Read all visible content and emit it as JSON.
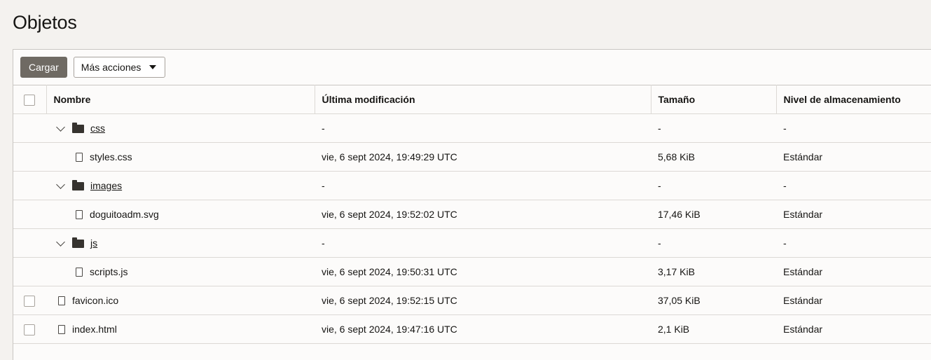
{
  "page": {
    "title": "Objetos"
  },
  "toolbar": {
    "upload_label": "Cargar",
    "more_actions_label": "Más acciones"
  },
  "table": {
    "columns": [
      "Nombre",
      "Última modificación",
      "Tamaño",
      "Nivel de almacenamiento"
    ],
    "rows": [
      {
        "name": "css",
        "modified": "-",
        "size": "-",
        "tier": "-"
      },
      {
        "name": "styles.css",
        "modified": "vie, 6 sept 2024, 19:49:29 UTC",
        "size": "5,68 KiB",
        "tier": "Estándar"
      },
      {
        "name": "images",
        "modified": "-",
        "size": "-",
        "tier": "-"
      },
      {
        "name": "doguitoadm.svg",
        "modified": "vie, 6 sept 2024, 19:52:02 UTC",
        "size": "17,46 KiB",
        "tier": "Estándar"
      },
      {
        "name": "js",
        "modified": "-",
        "size": "-",
        "tier": "-"
      },
      {
        "name": "scripts.js",
        "modified": "vie, 6 sept 2024, 19:50:31 UTC",
        "size": "3,17 KiB",
        "tier": "Estándar"
      },
      {
        "name": "favicon.ico",
        "modified": "vie, 6 sept 2024, 19:52:15 UTC",
        "size": "37,05 KiB",
        "tier": "Estándar"
      },
      {
        "name": "index.html",
        "modified": "vie, 6 sept 2024, 19:47:16 UTC",
        "size": "2,1 KiB",
        "tier": "Estándar"
      }
    ]
  },
  "icons": {
    "folder": "folder-icon",
    "file": "file-icon",
    "expand": "chevron-down-icon",
    "dropdown": "caret-down-icon"
  }
}
